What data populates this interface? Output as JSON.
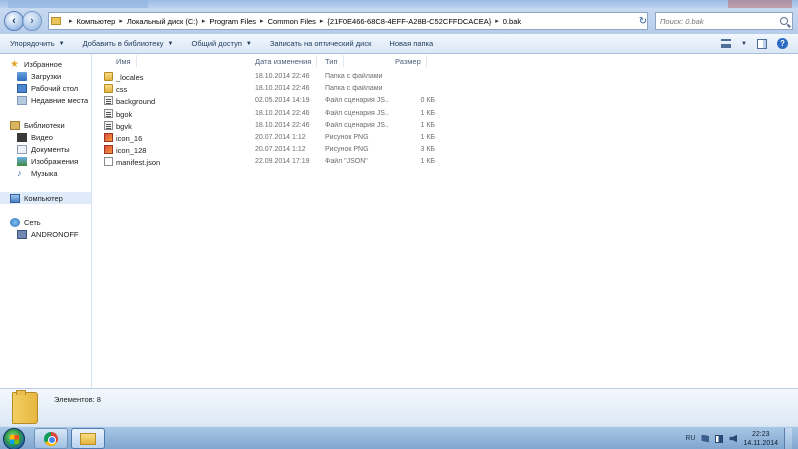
{
  "address_bar": {
    "breadcrumbs": [
      "Компьютер",
      "Локальный диск (C:)",
      "Program Files",
      "Common Files",
      "{21F0E466-68C8-4EFF-A28B-C52CFFDCACEA}",
      "0.bak"
    ],
    "search_placeholder": "Поиск: 0.bak"
  },
  "toolbar": {
    "organize": "Упорядочить",
    "add_to_library": "Добавить в библиотеку",
    "share": "Общий доступ",
    "burn": "Записать на оптический диск",
    "new_folder": "Новая папка"
  },
  "sidebar": {
    "favorites": {
      "label": "Избранное",
      "items": [
        "Загрузки",
        "Рабочий стол",
        "Недавние места"
      ]
    },
    "libraries": {
      "label": "Библиотеки",
      "items": [
        "Видео",
        "Документы",
        "Изображения",
        "Музыка"
      ]
    },
    "computer": "Компьютер",
    "network": {
      "label": "Сеть",
      "items": [
        "ANDRONOFF"
      ]
    }
  },
  "columns": {
    "name": "Имя",
    "date": "Дата изменения",
    "type": "Тип",
    "size": "Размер"
  },
  "files": [
    {
      "name": "_locales",
      "date": "18.10.2014 22:46",
      "type": "Папка с файлами",
      "size": "",
      "icon": "folder-icon"
    },
    {
      "name": "css",
      "date": "18.10.2014 22:46",
      "type": "Папка с файлами",
      "size": "",
      "icon": "folder-icon"
    },
    {
      "name": "background",
      "date": "02.05.2014 14:19",
      "type": "Файл сценария JS...",
      "size": "0 КБ",
      "icon": "script-file-icon"
    },
    {
      "name": "bgok",
      "date": "18.10.2014 22:46",
      "type": "Файл сценария JS...",
      "size": "1 КБ",
      "icon": "script-file-icon"
    },
    {
      "name": "bgvk",
      "date": "18.10.2014 22:46",
      "type": "Файл сценария JS...",
      "size": "1 КБ",
      "icon": "script-file-icon"
    },
    {
      "name": "icon_16",
      "date": "20.07.2014 1:12",
      "type": "Рисунок PNG",
      "size": "1 КБ",
      "icon": "png-image-icon"
    },
    {
      "name": "icon_128",
      "date": "20.07.2014 1:12",
      "type": "Рисунок PNG",
      "size": "3 КБ",
      "icon": "png-image-icon"
    },
    {
      "name": "manifest.json",
      "date": "22.09.2014 17:19",
      "type": "Файл \"JSON\"",
      "size": "1 КБ",
      "icon": "json-file-icon"
    }
  ],
  "details": {
    "items_label": "Элементов:",
    "items_count": "8"
  },
  "taskbar": {
    "language": "RU",
    "time": "22:23",
    "date": "14.11.2014"
  }
}
